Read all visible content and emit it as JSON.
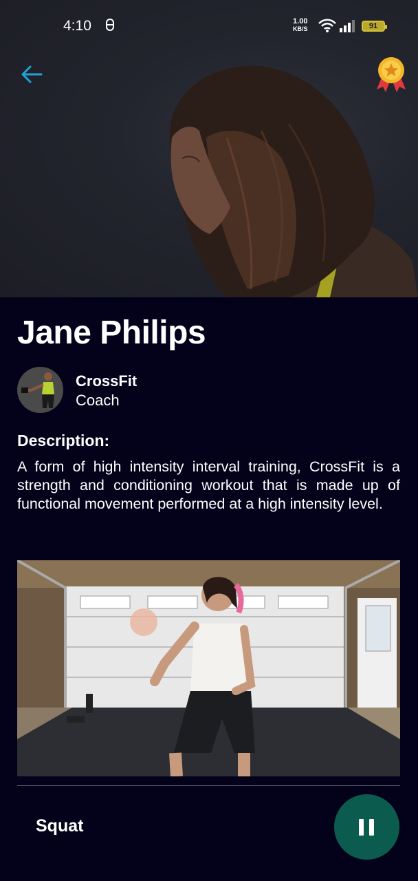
{
  "status_bar": {
    "time": "4:10",
    "sync_icon": "sync-icon",
    "net_speed_value": "1.00",
    "net_speed_unit": "KB/S",
    "battery": "91"
  },
  "header": {
    "back_icon": "arrow-left-icon",
    "badge_icon": "medal-icon",
    "accent_color": "#1fa4d6"
  },
  "coach": {
    "name": "Jane Philips",
    "category": "CrossFit",
    "role": "Coach"
  },
  "description": {
    "title": "Description:",
    "text": "A form of high intensity interval training, CrossFit is a strength and conditioning workout that is made up of functional movement performed at a high intensity level."
  },
  "player": {
    "exercise": "Squat",
    "pause_icon": "pause-icon",
    "button_color": "#0b5c4f"
  }
}
